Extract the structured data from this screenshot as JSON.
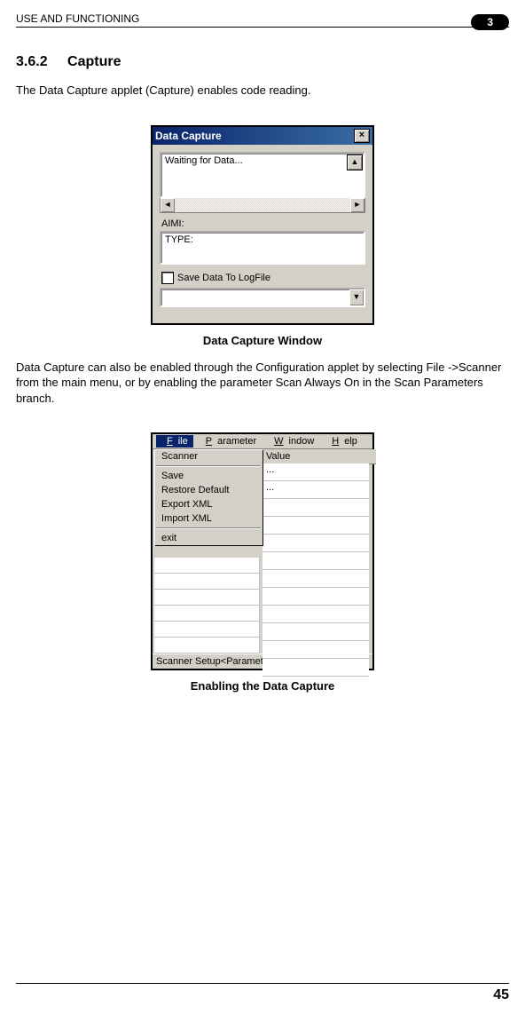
{
  "header": {
    "left": "USE AND FUNCTIONING",
    "badge": "3"
  },
  "section": {
    "number": "3.6.2",
    "title": "Capture"
  },
  "para1": "The Data Capture applet (Capture) enables code reading.",
  "fig1": {
    "title": "Data Capture",
    "waiting": "Waiting for Data...",
    "aimi": "AIMI:",
    "type": "TYPE:",
    "save": "Save Data To LogFile",
    "caption": "Data Capture Window"
  },
  "para2": "Data Capture can also be enabled through the Configuration applet by selecting File ->Scanner from the main menu, or by enabling the parameter Scan Always On in the Scan Parameters branch.",
  "fig2": {
    "menu": {
      "file": "File",
      "parameter": "Parameter",
      "window": "Window",
      "help": "Help"
    },
    "valueHeader": "Value",
    "items": [
      "Scanner",
      "Save",
      "Restore Default",
      "Export XML",
      "Import XML",
      "exit"
    ],
    "rightValues": [
      "...",
      "..."
    ],
    "status": "Scanner Setup<Parameters>",
    "caption": "Enabling the Data Capture"
  },
  "footer": {
    "page": "45"
  }
}
